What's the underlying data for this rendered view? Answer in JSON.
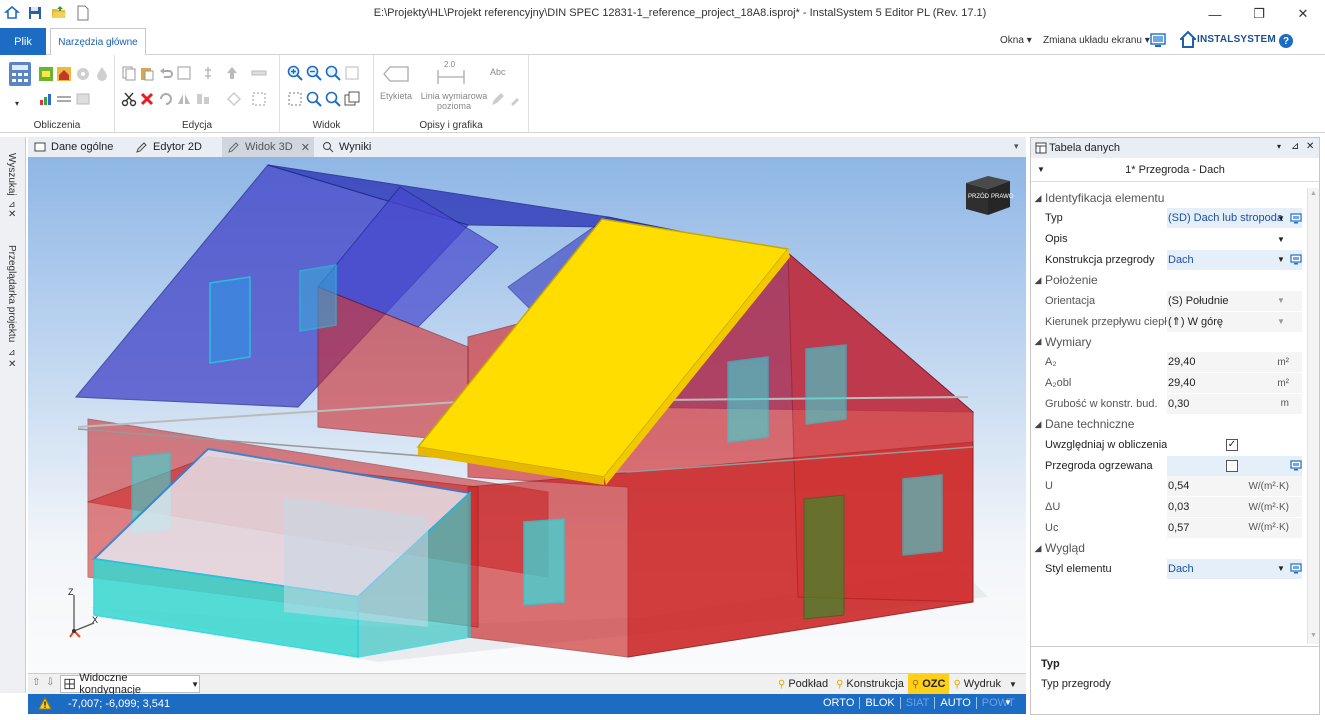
{
  "window": {
    "title": "E:\\Projekty\\HL\\Projekt referencyjny\\DIN SPEC 12831-1_reference_project_18A8.isproj* - InstalSystem 5 Editor PL (Rev. 17.1)",
    "minimize": "—",
    "restore": "❐",
    "close": "✕"
  },
  "menu": {
    "file_tab": "Plik",
    "main_tab": "Narzędzia główne",
    "okna": "Okna",
    "zmiana": "Zmiana układu ekranu",
    "logo_text": "INSTALSYSTEM",
    "help": "?"
  },
  "ribbon": {
    "groups": [
      "Obliczenia",
      "Edycja",
      "Widok",
      "Opisy i grafika"
    ],
    "etykieta": "Etykieta",
    "linia_line1": "Linia wymiarowa",
    "linia_line2": "pozioma",
    "dim_value": "2.0",
    "abc": "Abc"
  },
  "tabs": [
    "Dane ogólne",
    "Edytor 2D",
    "Widok 3D",
    "Wyniki"
  ],
  "left_panels": [
    "Wyszukaj",
    "Przeglądarka projektu"
  ],
  "viewcube": {
    "left": "PRZÓD",
    "right": "PRAWO"
  },
  "axis": {
    "z": "Z",
    "x": "X"
  },
  "viewport_bottom": {
    "storeys": "Widoczne kondygnacje",
    "tabs": [
      "Podkład",
      "Konstrukcja",
      "OZC",
      "Wydruk"
    ]
  },
  "status": {
    "coords": "-7,007; -6,099; 3,541",
    "toggles": [
      "ORTO",
      "BLOK",
      "SIAT",
      "AUTO",
      "POWT"
    ],
    "active": [
      true,
      true,
      false,
      true,
      false
    ]
  },
  "panel": {
    "title": "Tabela danych",
    "element": "1* Przegroda - Dach",
    "sections": [
      {
        "name": "Identyfikacja elementu",
        "rows": [
          {
            "name": "Typ",
            "value": "(SD) Dach lub stropoda",
            "unit": "",
            "style": "blue",
            "dd": true,
            "edit": true
          },
          {
            "name": "Opis",
            "value": "",
            "unit": "",
            "style": "plain",
            "dd": true,
            "edit": false
          },
          {
            "name": "Konstrukcja przegrody",
            "value": "Dach",
            "unit": "",
            "style": "blue",
            "dd": true,
            "edit": true
          }
        ]
      },
      {
        "name": "Położenie",
        "rows": [
          {
            "name": "Orientacja",
            "value": "(S) Południe",
            "unit": "",
            "style": "muted",
            "dd": true,
            "edit": false
          },
          {
            "name": "Kierunek przepływu ciepła",
            "value": "(⇑) W górę",
            "unit": "",
            "style": "muted",
            "dd": true,
            "edit": false
          }
        ]
      },
      {
        "name": "Wymiary",
        "rows": [
          {
            "name": "A₂",
            "value": "29,40",
            "unit": "m²",
            "style": "muted",
            "dd": false,
            "edit": false
          },
          {
            "name": "A₂obl",
            "value": "29,40",
            "unit": "m²",
            "style": "muted",
            "dd": false,
            "edit": false
          },
          {
            "name": "Grubość w konstr. bud.",
            "value": "0,30",
            "unit": "m",
            "style": "muted",
            "dd": false,
            "edit": false
          }
        ]
      },
      {
        "name": "Dane techniczne",
        "rows": [
          {
            "name": "Uwzględniaj w obliczeniach",
            "value": "",
            "unit": "",
            "style": "check",
            "checked": true,
            "dd": false,
            "edit": false
          },
          {
            "name": "Przegroda ogrzewana",
            "value": "",
            "unit": "",
            "style": "check",
            "checked": false,
            "dd": false,
            "edit": true
          },
          {
            "name": "U",
            "value": "0,54",
            "unit": "W/(m²·K)",
            "style": "muted",
            "dd": false,
            "edit": false
          },
          {
            "name": "ΔU",
            "value": "0,03",
            "unit": "W/(m²·K)",
            "style": "muted",
            "dd": false,
            "edit": false
          },
          {
            "name": "Uc",
            "value": "0,57",
            "unit": "W/(m²·K)",
            "style": "muted",
            "dd": false,
            "edit": false
          }
        ]
      },
      {
        "name": "Wygląd",
        "rows": [
          {
            "name": "Styl elementu",
            "value": "Dach",
            "unit": "",
            "style": "blue",
            "dd": true,
            "edit": true
          }
        ]
      }
    ],
    "desc_title": "Typ",
    "desc_text": "Typ przegrody"
  },
  "colors": {
    "accent": "#1d6cc4",
    "wall_red": "#cc1f1f",
    "roof_blue": "#2b37b8",
    "selected_roof": "#ffdd00",
    "glass_cyan": "#3fd6d0"
  }
}
